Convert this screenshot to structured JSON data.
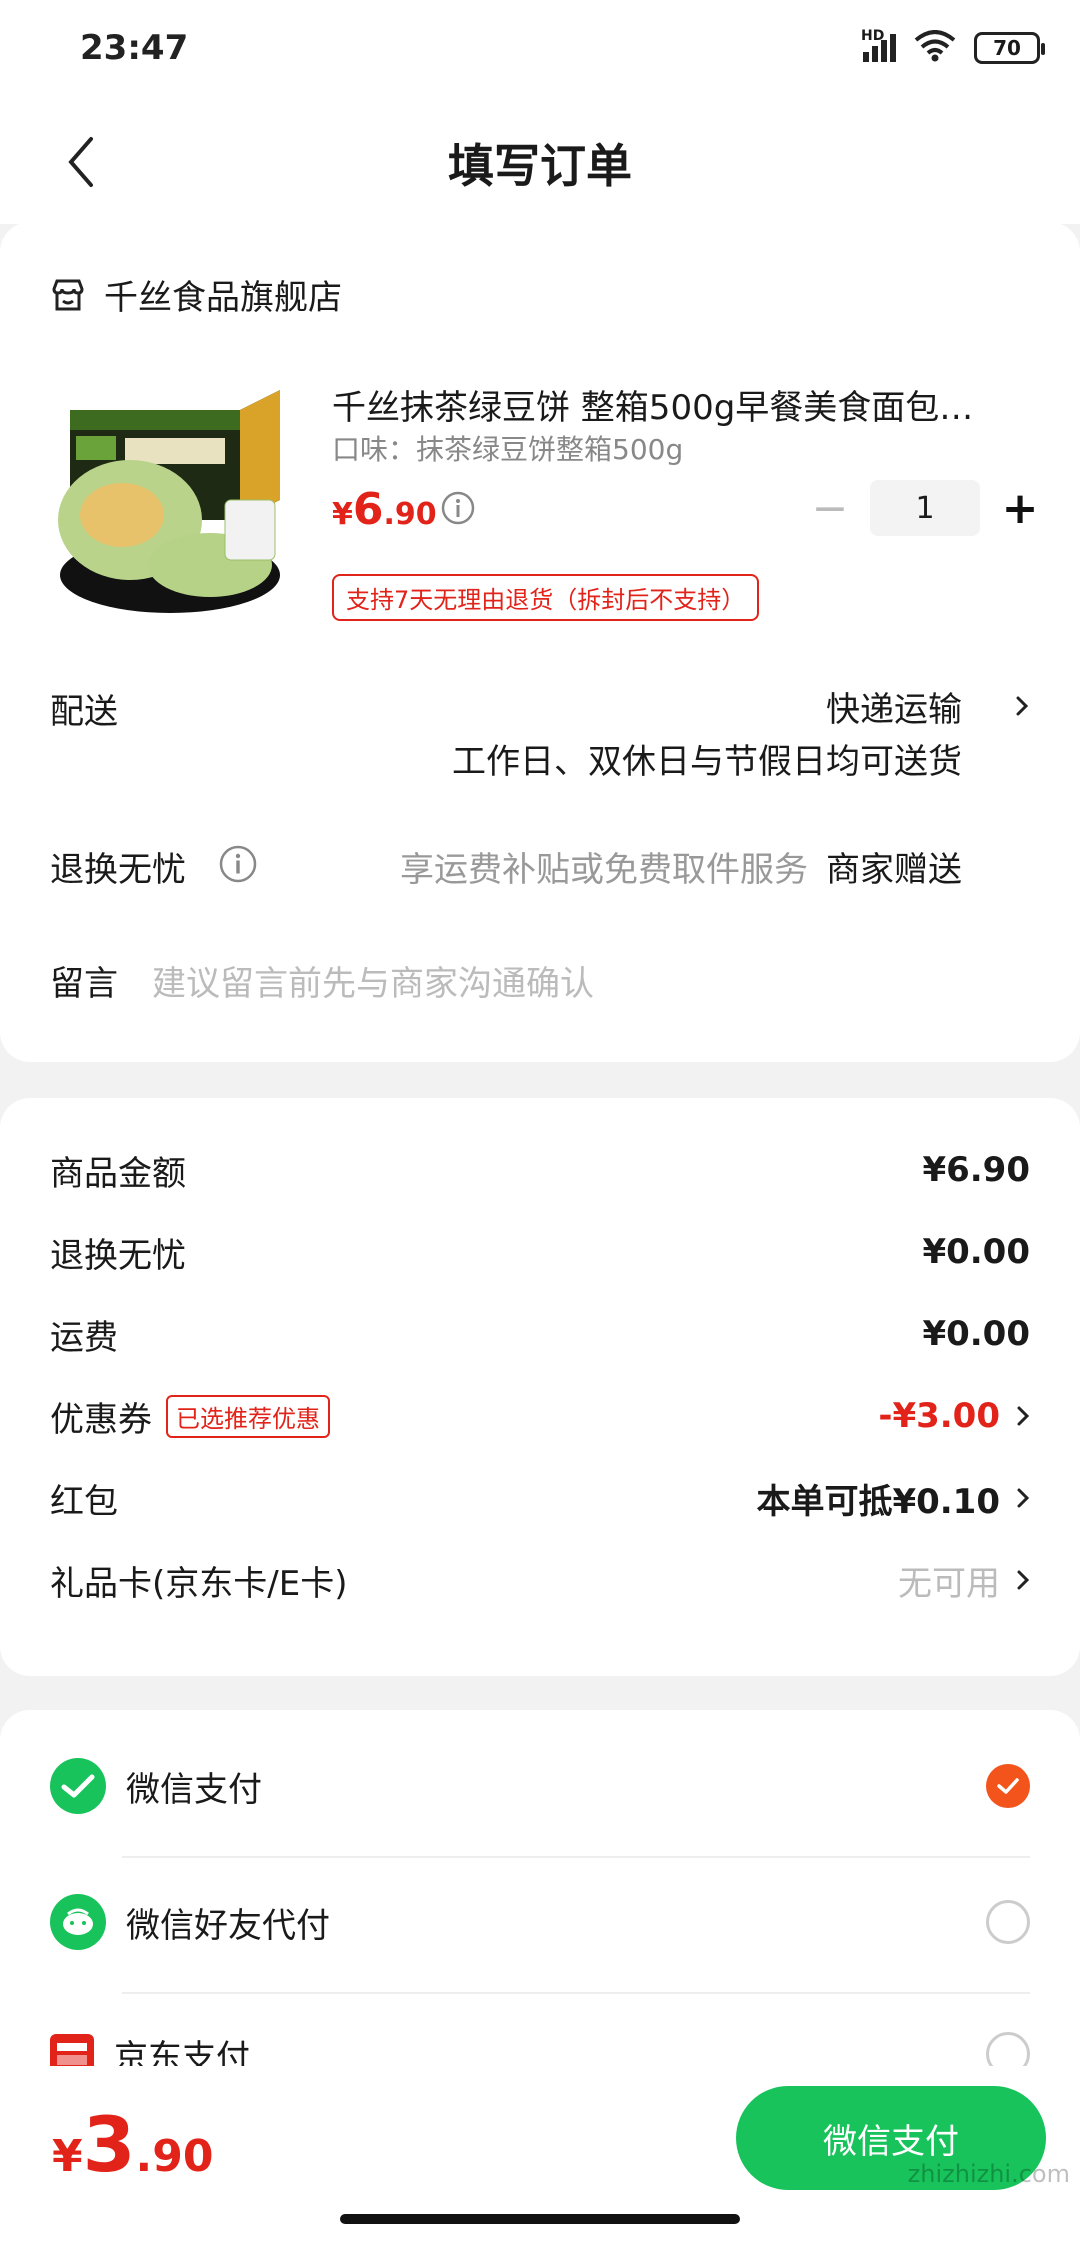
{
  "status_bar": {
    "time": "23:47",
    "network_label": "HD",
    "battery": "70"
  },
  "header": {
    "title": "填写订单"
  },
  "shop": {
    "name": "千丝食品旗舰店"
  },
  "product": {
    "title": "千丝抹茶绿豆饼 整箱500g早餐美食面包…",
    "spec": "口味：抹茶绿豆饼整箱500g",
    "price_currency": "¥",
    "price_int": "6",
    "price_dec": ".90",
    "quantity": "1",
    "return_policy": "支持7天无理由退货（拆封后不支持）"
  },
  "delivery": {
    "label": "配送",
    "method": "快递运输",
    "note": "工作日、双休日与节假日均可送货"
  },
  "worry_free": {
    "label": "退换无忧",
    "desc": "享运费补贴或免费取件服务",
    "value": "商家赠送"
  },
  "message": {
    "label": "留言",
    "placeholder": "建议留言前先与商家沟通确认"
  },
  "summary": {
    "goods_label": "商品金额",
    "goods_value": "¥6.90",
    "worry_label": "退换无忧",
    "worry_value": "¥0.00",
    "shipping_label": "运费",
    "shipping_value": "¥0.00",
    "coupon_label": "优惠券",
    "coupon_badge": "已选推荐优惠",
    "coupon_value": "-¥3.00",
    "redpacket_label": "红包",
    "redpacket_value": "本单可抵¥0.10",
    "giftcard_label": "礼品卡(京东卡/E卡)",
    "giftcard_value": "无可用"
  },
  "payment": {
    "options": [
      {
        "label": "微信支付",
        "selected": true
      },
      {
        "label": "微信好友代付",
        "selected": false
      },
      {
        "label": "京东支付",
        "selected": false
      }
    ]
  },
  "bottom": {
    "currency": "¥",
    "total_int": "3",
    "total_dec": ".90",
    "pay_button": "微信支付",
    "watermark": "zhizhizhi.com"
  },
  "colors": {
    "accent_red": "#e2231a",
    "wechat_green": "#17c35a",
    "check_orange": "#f2541b"
  }
}
